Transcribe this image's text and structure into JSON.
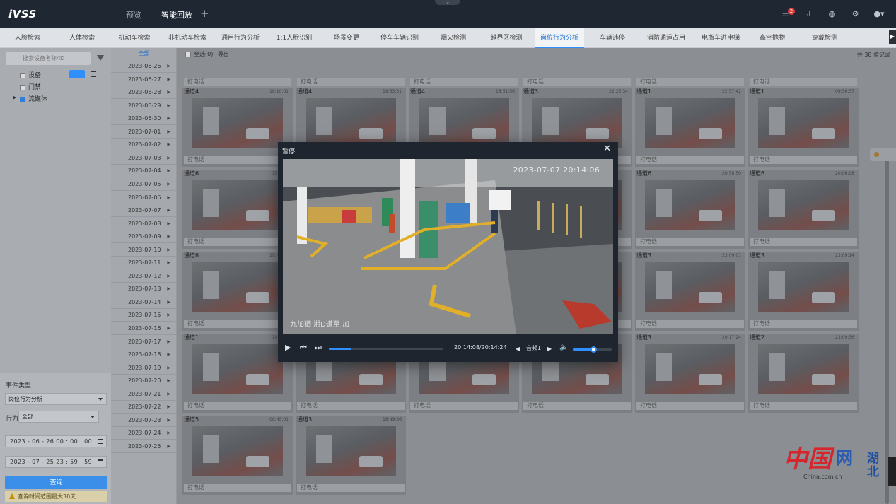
{
  "topbar": {
    "logo": "iVSS",
    "tabs": [
      "预览",
      "智能回放"
    ],
    "active_tab": "智能回放",
    "add_tab_symbol": "+",
    "notification_count": "2",
    "collapse_symbol": "⌄"
  },
  "subtabs": {
    "items": [
      "人脸检索",
      "人体检索",
      "机动车检索",
      "非机动车检索",
      "通用行为分析",
      "1:1人脸识别",
      "场景变更",
      "停车车辆识别",
      "烟火检测",
      "越界区检测",
      "岗位行为分析",
      "车辆违停",
      "消防通道占用",
      "电瓶车进电梯",
      "高空抛物",
      "穿戴检测"
    ],
    "active": "岗位行为分析"
  },
  "left": {
    "search_placeholder": "搜索设备名称/ID",
    "tree": [
      {
        "label": "设备",
        "checked": false
      },
      {
        "label": "门禁",
        "checked": false
      },
      {
        "label": "流媒体",
        "checked": true
      }
    ],
    "event_type_label": "事件类型",
    "event_type_value": "岗位行为分析",
    "behavior_label": "行为",
    "behavior_value": "全部",
    "start_time": "2023 - 06 - 26   00 : 00 : 00",
    "end_time": "2023 - 07 - 25   23 : 59 : 59",
    "query_button": "查询",
    "warning": "查询时间范围最大30天"
  },
  "dates": {
    "header": "全部",
    "items": [
      "2023-06-26",
      "2023-06-27",
      "2023-06-28",
      "2023-06-29",
      "2023-06-30",
      "2023-07-01",
      "2023-07-02",
      "2023-07-03",
      "2023-07-04",
      "2023-07-05",
      "2023-07-06",
      "2023-07-07",
      "2023-07-08",
      "2023-07-09",
      "2023-07-10",
      "2023-07-11",
      "2023-07-12",
      "2023-07-13",
      "2023-07-14",
      "2023-07-15",
      "2023-07-16",
      "2023-07-17",
      "2023-07-18",
      "2023-07-19",
      "2023-07-20",
      "2023-07-21",
      "2023-07-22",
      "2023-07-23",
      "2023-07-24",
      "2023-07-25"
    ]
  },
  "main": {
    "select_all": "全选(0)",
    "export": "导出",
    "record_count": "共 38 条记录",
    "card_foot": "打电话",
    "cards": [
      {
        "channel": "通道4",
        "time": "18:10:01"
      },
      {
        "channel": "通道4",
        "time": "19:53:51"
      },
      {
        "channel": "通道4",
        "time": "18:51:56"
      },
      {
        "channel": "通道3",
        "time": "22:25:34"
      },
      {
        "channel": "通道1",
        "time": "22:57:42"
      },
      {
        "channel": "通道1",
        "time": "09:56:37"
      },
      {
        "channel": "通道6",
        "time": "19:10:0"
      },
      {
        "channel": "",
        "time": ""
      },
      {
        "channel": "",
        "time": ""
      },
      {
        "channel": "",
        "time": ""
      },
      {
        "channel": "通道6",
        "time": "20:58:50"
      },
      {
        "channel": "通道6",
        "time": "20:06:08"
      },
      {
        "channel": "通道6",
        "time": "19:40:45"
      },
      {
        "channel": "",
        "time": ""
      },
      {
        "channel": "",
        "time": ""
      },
      {
        "channel": "",
        "time": ""
      },
      {
        "channel": "通道3",
        "time": "23:09:01"
      },
      {
        "channel": "通道3",
        "time": "23:09:14"
      },
      {
        "channel": "通道1",
        "time": "14:07:0"
      },
      {
        "channel": "",
        "time": ""
      },
      {
        "channel": "",
        "time": ""
      },
      {
        "channel": "",
        "time": ""
      },
      {
        "channel": "通道3",
        "time": "20:17:24"
      },
      {
        "channel": "通道2",
        "time": "23:09:36"
      },
      {
        "channel": "通道5",
        "time": "08:45:01"
      },
      {
        "channel": "通道3",
        "time": "18:49:36"
      }
    ]
  },
  "player": {
    "title": "暂停",
    "close_symbol": "✕",
    "osd_time": "2023-07-07 20:14:06",
    "osd_name": "九加硒 湘D道至 加",
    "time_display": "20:14:08/20:14:24",
    "progress_fraction": 0.2,
    "audio_label": "音频1",
    "volume_fraction": 0.52
  },
  "watermark": {
    "china": "中国",
    "net": "网",
    "url": "China.com.cn",
    "region": "湖北"
  }
}
